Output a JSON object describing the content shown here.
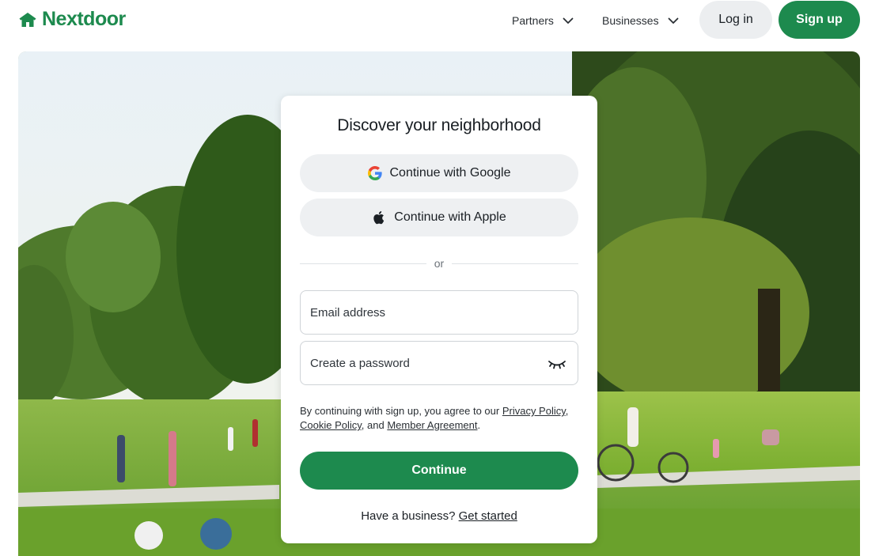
{
  "header": {
    "brand": "Nextdoor",
    "nav": [
      {
        "label": "Partners"
      },
      {
        "label": "Businesses"
      }
    ],
    "login_label": "Log in",
    "signup_label": "Sign up"
  },
  "signup_card": {
    "title": "Discover your neighborhood",
    "google_label": "Continue with Google",
    "apple_label": "Continue with Apple",
    "divider_text": "or",
    "email_placeholder": "Email address",
    "password_placeholder": "Create a password",
    "legal": {
      "prefix": "By continuing with sign up, you agree to our ",
      "privacy": "Privacy Policy",
      "sep1": ", ",
      "cookie": "Cookie Policy",
      "sep2": ", and ",
      "member": "Member Agreement",
      "suffix": "."
    },
    "continue_label": "Continue",
    "business_prompt": "Have a business?",
    "business_link": "Get started"
  },
  "colors": {
    "brand_green": "#1d8a4e",
    "button_gray": "#eceef0"
  },
  "icons": {
    "logo": "house-icon",
    "nav_chevron": "chevron-down-icon",
    "google": "google-icon",
    "apple": "apple-icon",
    "password_toggle": "eye-closed-icon"
  }
}
